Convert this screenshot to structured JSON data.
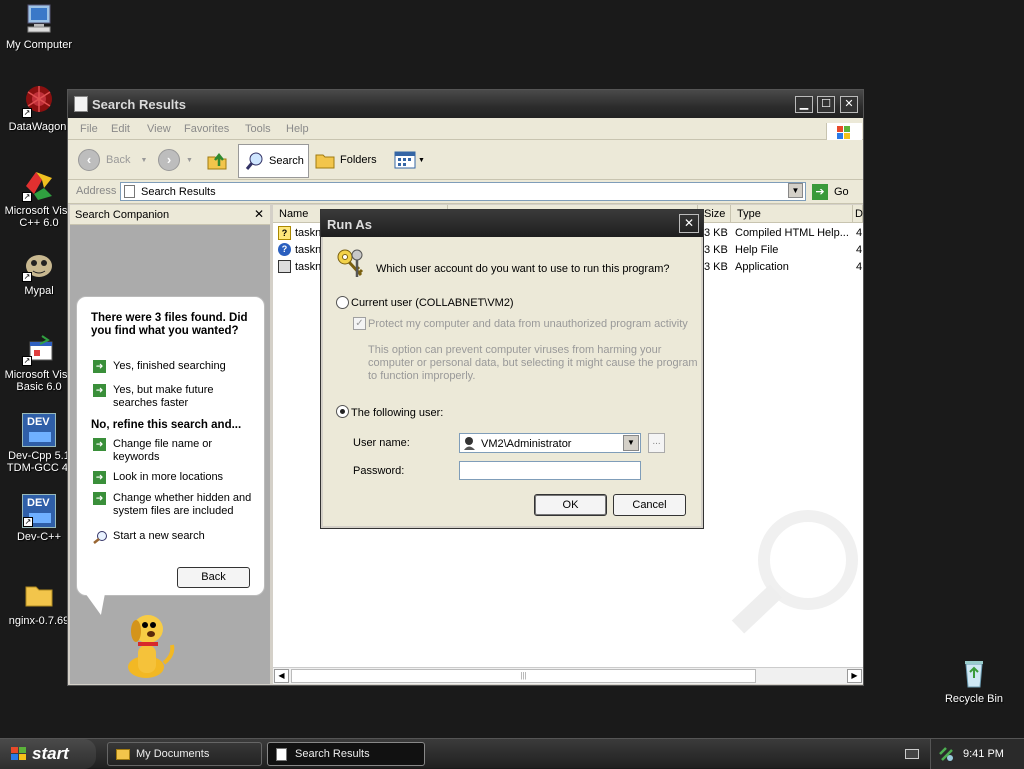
{
  "desktop": {
    "icons": [
      {
        "label": "My Computer",
        "icon": "computer-icon"
      },
      {
        "label": "DataWagon.",
        "icon": "datawagon-icon"
      },
      {
        "label": "Microsoft Visu",
        "label2": "C++ 6.0",
        "icon": "visual-cpp-icon"
      },
      {
        "label": "Mypal",
        "icon": "mypal-icon"
      },
      {
        "label": "Microsoft Visu",
        "label2": "Basic 6.0",
        "icon": "visual-basic-icon"
      },
      {
        "label": "Dev-Cpp 5.1",
        "label2": "TDM-GCC 4.",
        "icon": "devcpp-icon"
      },
      {
        "label": "Dev-C++",
        "icon": "devcpp2-icon"
      },
      {
        "label": "nginx-0.7.69",
        "icon": "folder-icon"
      },
      {
        "label": "Recycle Bin",
        "icon": "recycle-bin-icon"
      }
    ],
    "dev_badge": "DEV"
  },
  "explorer": {
    "title": "Search Results",
    "menu": [
      "File",
      "Edit",
      "View",
      "Favorites",
      "Tools",
      "Help"
    ],
    "toolbar": {
      "back": "Back",
      "search": "Search",
      "folders": "Folders"
    },
    "address_label": "Address",
    "address_value": "Search Results",
    "go_label": "Go",
    "companion": {
      "header": "Search Companion",
      "found_text": "There were 3 files found. Did you find what you wanted?",
      "opt1": "Yes, finished searching",
      "opt2": "Yes, but make future searches faster",
      "refine_heading": "No, refine this search and...",
      "ref1": "Change file name or keywords",
      "ref2": "Look in more locations",
      "ref3": "Change whether hidden and system files are included",
      "new_search": "Start a new search",
      "back_button": "Back"
    },
    "columns": {
      "name": "Name",
      "size": "Size",
      "type": "Type",
      "date": "D"
    },
    "files": [
      {
        "name": "taskn",
        "size": "3 KB",
        "type": "Compiled HTML Help...",
        "extra": "4"
      },
      {
        "name": "taskn",
        "size": "3 KB",
        "type": "Help File",
        "extra": "4"
      },
      {
        "name": "taskn",
        "size": "3 KB",
        "type": "Application",
        "extra": "4"
      }
    ]
  },
  "runas": {
    "title": "Run As",
    "question": "Which user account do you want to use to run this program?",
    "current_user": "Current user (COLLABNET\\VM2)",
    "protect_label": "Protect my computer and data from unauthorized program activity",
    "protect_desc": "This option can prevent computer viruses from harming your computer or personal data, but selecting it might cause the program to function improperly.",
    "following_user": "The following user:",
    "username_label": "User name:",
    "username_value": "VM2\\Administrator",
    "password_label": "Password:",
    "browse_label": "...",
    "ok": "OK",
    "cancel": "Cancel",
    "close": "✕"
  },
  "taskbar": {
    "start": "start",
    "tasks": [
      {
        "label": "My Documents"
      },
      {
        "label": "Search Results"
      }
    ],
    "clock": "9:41 PM"
  }
}
